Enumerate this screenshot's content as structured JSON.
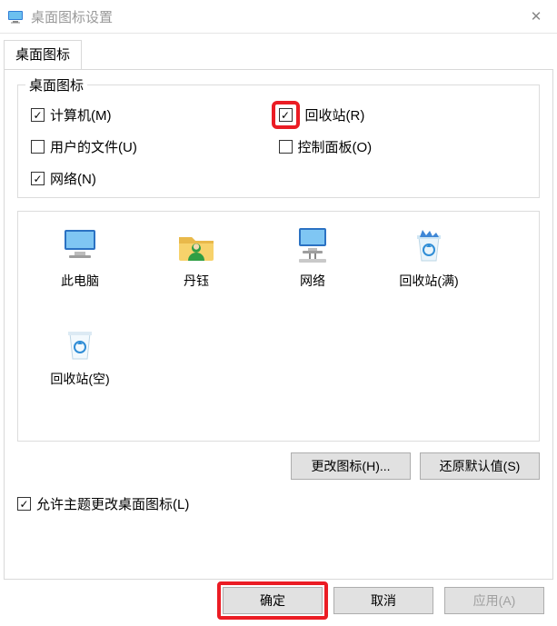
{
  "window": {
    "title": "桌面图标设置"
  },
  "tabs": {
    "desktop_icons_label": "桌面图标"
  },
  "group": {
    "legend": "桌面图标",
    "items": {
      "computer": {
        "label": "计算机(M)",
        "checked": true
      },
      "recyclebin": {
        "label": "回收站(R)",
        "checked": true
      },
      "userfiles": {
        "label": "用户的文件(U)",
        "checked": false
      },
      "controlpanel": {
        "label": "控制面板(O)",
        "checked": false
      },
      "network": {
        "label": "网络(N)",
        "checked": true
      }
    }
  },
  "icons": {
    "this_pc": "此电脑",
    "user": "丹钰",
    "network": "网络",
    "bin_full": "回收站(满)",
    "bin_empty": "回收站(空)"
  },
  "buttons": {
    "change_icon": "更改图标(H)...",
    "restore_default": "还原默认值(S)",
    "ok": "确定",
    "cancel": "取消",
    "apply": "应用(A)"
  },
  "allow_theme": {
    "label": "允许主题更改桌面图标(L)",
    "checked": true
  }
}
